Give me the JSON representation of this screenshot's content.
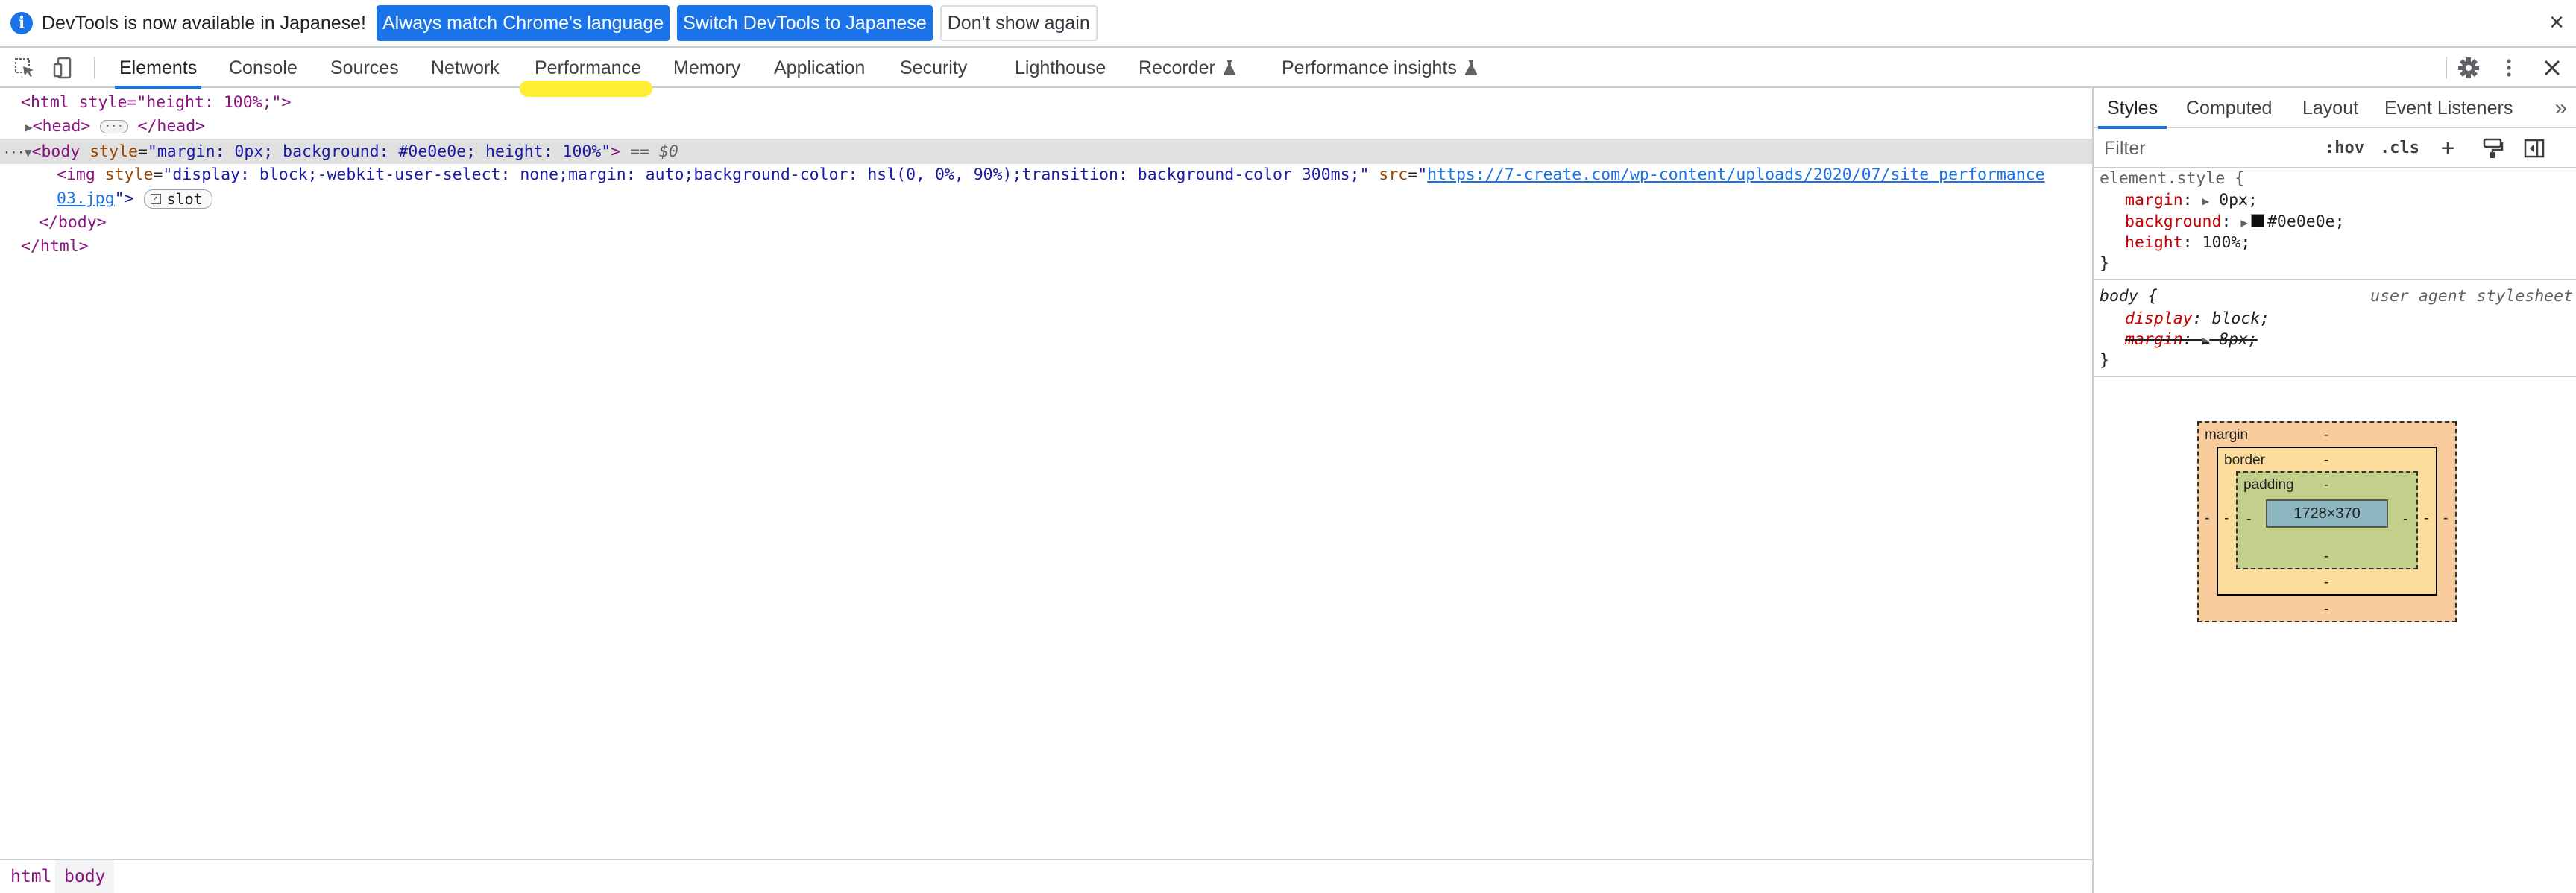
{
  "infobar": {
    "message": "DevTools is now available in Japanese!",
    "btn_match": "Always match Chrome's language",
    "btn_switch": "Switch DevTools to Japanese",
    "btn_dismiss": "Don't show again",
    "close": "×"
  },
  "toolbar": {
    "tabs": [
      "Elements",
      "Console",
      "Sources",
      "Network",
      "Performance",
      "Memory",
      "Application",
      "Security",
      "Lighthouse",
      "Recorder",
      "Performance insights"
    ],
    "active_tab": "Elements"
  },
  "dom": {
    "html_open": "<html style=\"height: 100%;\">",
    "head": "<head>",
    "head_close": "</head>",
    "ellipsis": "···",
    "body_tag": "<body",
    "body_attr_name": "style",
    "body_attr_value": "\"margin: 0px; background: #0e0e0e; height: 100%\"",
    "body_close_bracket": ">",
    "eq_ref": "== $0",
    "dots": "···",
    "img_tag": "<img",
    "img_style_attr": "style",
    "img_style_value": "\"display: block;-webkit-user-select: none;margin: auto;background-color: hsl(0, 0%, 90%);transition: background-color 300ms;\"",
    "img_src_attr": "src",
    "img_src_quote": "\"",
    "img_src_line1": "https://7-create.com/wp-content/uploads/2020/07/site_performance",
    "img_src_line2": "03.jpg",
    "img_end": "\">",
    "slot": "slot",
    "body_close": "</body>",
    "html_close": "</html>"
  },
  "breadcrumbs": [
    "html",
    "body"
  ],
  "sidebar": {
    "tabs": [
      "Styles",
      "Computed",
      "Layout",
      "Event Listeners"
    ],
    "active_tab": "Styles",
    "filter_placeholder": "Filter",
    "hov": ":hov",
    "cls": ".cls",
    "plus": "+",
    "element_style": {
      "selector": "element.style {",
      "props": [
        {
          "name": "margin",
          "value": "0px;"
        },
        {
          "name": "background",
          "value": "#0e0e0e;"
        },
        {
          "name": "height",
          "value": "100%;"
        }
      ],
      "close": "}"
    },
    "body_rule": {
      "selector": "body {",
      "source": "user agent stylesheet",
      "props": [
        {
          "name": "display",
          "value": "block;"
        },
        {
          "name": "margin",
          "value": "8px;"
        }
      ],
      "close": "}"
    },
    "box_model": {
      "margin_label": "margin",
      "border_label": "border",
      "padding_label": "padding",
      "content": "1728×370",
      "dash": "-"
    }
  },
  "colors": {
    "accent": "#1a73e8",
    "tag": "#881280",
    "attr": "#994500",
    "value": "#1a1aa6",
    "highlight": "#ffee33"
  }
}
